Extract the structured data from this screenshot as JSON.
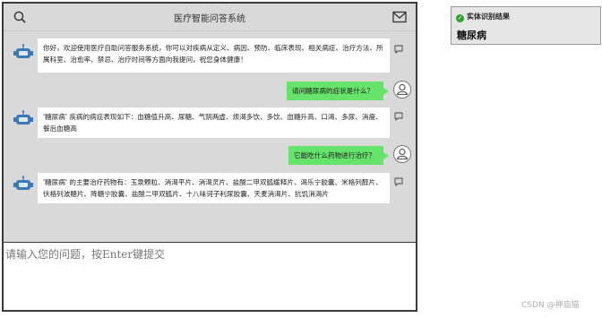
{
  "header": {
    "title": "医疗智能问答系统"
  },
  "messages": [
    {
      "role": "bot",
      "text": "你好，欢迎使用医疗自助问答服务系统，你可以对疾病从定义、病因、预防、临床表现、相关病症、治疗方法、所属科室、治愈率、禁忌、治疗时间等方面向我提问，祝您身体健康！"
    },
    {
      "role": "user",
      "text": "请问糖尿病的症状是什么？"
    },
    {
      "role": "bot",
      "text": "'糖尿病' 疾病的病症表现如下：血糖值升高、尿糖、气阴两虚、烦渴多饮、多饮、血糖升高、口渴、多尿、消瘦、餐后血糖高"
    },
    {
      "role": "user",
      "text": "它能吃什么药物进行治疗？"
    },
    {
      "role": "bot",
      "text": "'糖尿病' 的主要治疗药物有：玉泉颗粒、消渴平片、消渴灵片、盐酸二甲双胍缓释片、渴乐宁胶囊、米格列醇片、伏格列波糖片、降糖宁胶囊、盐酸二甲双胍片、十八味诃子利尿胶囊、天麦消渴片、抗饥消渴片"
    }
  ],
  "input": {
    "placeholder": "请输入您的问题，按Enter键提交"
  },
  "entity_panel": {
    "header": "实体识别结果",
    "value": "糖尿病"
  },
  "watermark": "CSDN @神庙猫",
  "icons": {
    "search": "search-icon",
    "mail": "mail-icon",
    "bot_avatar": "robot-icon",
    "user_avatar": "user-icon",
    "message_action": "message-icon",
    "check": "check-icon"
  },
  "colors": {
    "window_bg": "#d9d9d9",
    "user_bubble": "#66e36a",
    "bot_bubble": "#ffffff",
    "check": "#2aa52a"
  }
}
